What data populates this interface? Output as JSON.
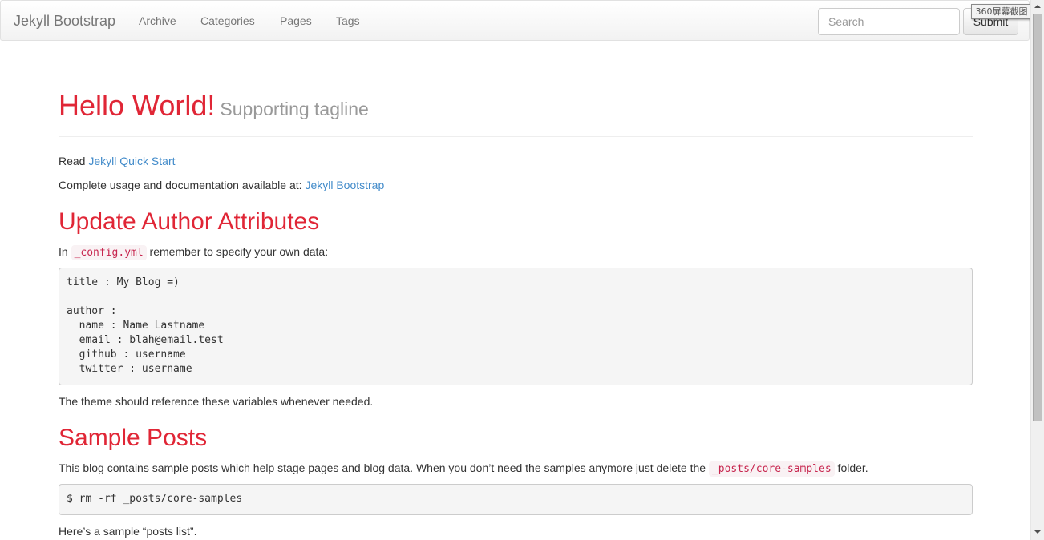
{
  "navbar": {
    "brand": "Jekyll Bootstrap",
    "links": [
      "Archive",
      "Categories",
      "Pages",
      "Tags"
    ],
    "search_placeholder": "Search",
    "submit_label": "Submit"
  },
  "overlay": {
    "stamp": "360屏幕截图"
  },
  "header": {
    "title": "Hello World!",
    "tagline": "Supporting tagline"
  },
  "intro": {
    "read_prefix": "Read ",
    "quick_start_link": "Jekyll Quick Start",
    "docs_prefix": "Complete usage and documentation available at: ",
    "docs_link": "Jekyll Bootstrap"
  },
  "author_section": {
    "heading": "Update Author Attributes",
    "in_prefix": "In ",
    "config_file": "_config.yml",
    "in_suffix": " remember to specify your own data:",
    "code": "title : My Blog =)\n\nauthor :\n  name : Name Lastname\n  email : blah@email.test\n  github : username\n  twitter : username",
    "note": "The theme should reference these variables whenever needed."
  },
  "posts_section": {
    "heading": "Sample Posts",
    "desc_prefix": "This blog contains sample posts which help stage pages and blog data. When you don’t need the samples anymore just delete the ",
    "folder": "_posts/core-samples",
    "desc_suffix": " folder.",
    "command": "$ rm -rf _posts/core-samples",
    "list_note": "Here’s a sample “posts list”."
  },
  "colors": {
    "heading_red": "#e02636",
    "link_blue": "#428bca",
    "code_pink": "#c7254e"
  }
}
